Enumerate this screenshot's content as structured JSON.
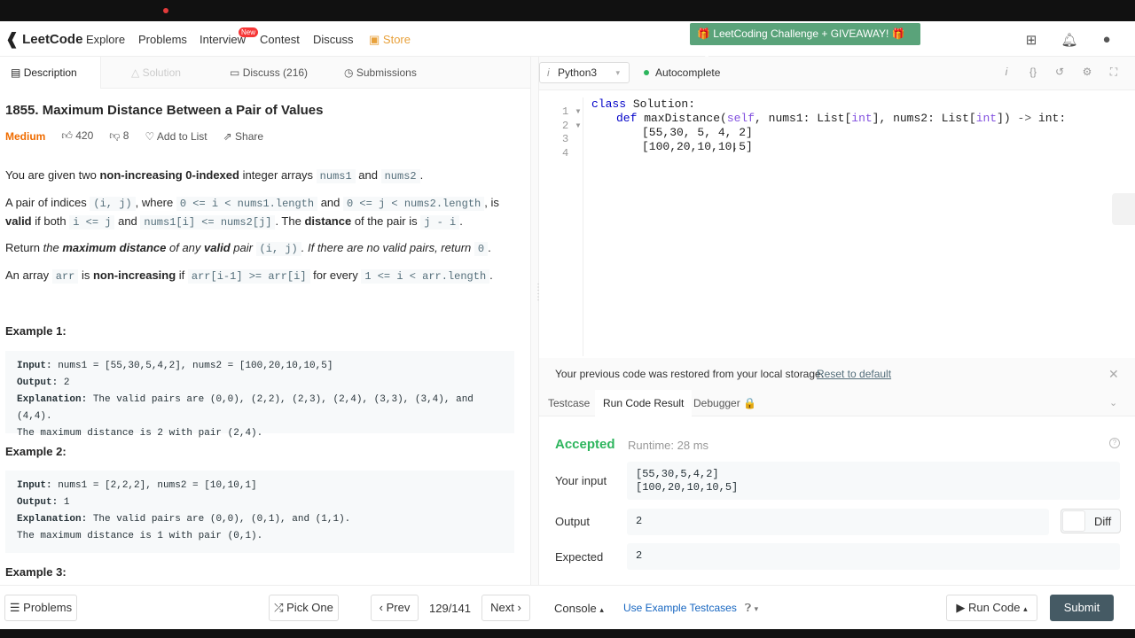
{
  "nav": {
    "logo": "LeetCode",
    "items": [
      "Explore",
      "Problems",
      "Interview",
      "Contest",
      "Discuss"
    ],
    "new_badge": "New",
    "store": "Store",
    "banner": "🎁 LeetCoding Challenge + GIVEAWAY! 🎁"
  },
  "left_tabs": {
    "description": "Description",
    "solution": "Solution",
    "discuss": "Discuss (216)",
    "submissions": "Submissions"
  },
  "problem": {
    "title": "1855. Maximum Distance Between a Pair of Values",
    "difficulty": "Medium",
    "likes": "420",
    "dislikes": "8",
    "add_to_list": "Add to List",
    "share": "Share"
  },
  "desc": {
    "p1a": "You are given two ",
    "p1b": "non-increasing 0-indexed",
    "p1c": " integer arrays ",
    "p1d": "nums1",
    "p1e": " and ",
    "p1f": "nums2",
    "p1g": ".",
    "p2a": "A pair of indices ",
    "p2b": "(i, j)",
    "p2c": ", where ",
    "p2d": "0 <= i < nums1.length",
    "p2e": " and ",
    "p2f": "0 <= j < nums2.length",
    "p2g": ", is",
    "p2h": "valid",
    "p2i": " if both ",
    "p2j": "i <= j",
    "p2k": " and ",
    "p2l": "nums1[i] <= nums2[j]",
    "p2m": ". The ",
    "p2n": "distance",
    "p2o": " of the pair is ",
    "p2p": "j - i",
    "p2q": ".",
    "p3a": "Return ",
    "p3b": "the ",
    "p3c": "maximum distance",
    "p3d": " of any ",
    "p3e": "valid",
    "p3f": " pair ",
    "p3g": "(i, j)",
    "p3h": ". If there are no valid pairs, return ",
    "p3i": "0",
    "p3j": ".",
    "p4a": "An array ",
    "p4b": "arr",
    "p4c": " is ",
    "p4d": "non-increasing",
    "p4e": " if ",
    "p4f": "arr[i-1] >= arr[i]",
    "p4g": " for every ",
    "p4h": "1 <= i < arr.length",
    "p4i": "."
  },
  "examples": [
    {
      "title": "Example 1:",
      "input_label": "Input:",
      "input": " nums1 = [55,30,5,4,2], nums2 = [100,20,10,10,5]",
      "output_label": "Output:",
      "output": " 2",
      "expl_label": "Explanation:",
      "expl": " The valid pairs are (0,0), (2,2), (2,3), (2,4), (3,3), (3,4), and (4,4).",
      "expl2": "The maximum distance is 2 with pair (2,4)."
    },
    {
      "title": "Example 2:",
      "input_label": "Input:",
      "input": " nums1 = [2,2,2], nums2 = [10,10,1]",
      "output_label": "Output:",
      "output": " 1",
      "expl_label": "Explanation:",
      "expl": " The valid pairs are (0,0), (0,1), and (1,1).",
      "expl2": "The maximum distance is 1 with pair (0,1)."
    },
    {
      "title": "Example 3:"
    }
  ],
  "editor": {
    "language": "Python3",
    "autocomplete": "Autocomplete",
    "lines": [
      {
        "num": "1",
        "fold": "▾"
      },
      {
        "num": "2",
        "fold": "▾"
      },
      {
        "num": "3",
        "fold": ""
      },
      {
        "num": "4",
        "fold": ""
      }
    ],
    "code": {
      "l1_kw": "class",
      "l1_rest": " Solution:",
      "l2_kw": "def",
      "l2_a": " maxDistance(",
      "l2_self": "self",
      "l2_b": ", nums1: List[",
      "l2_int1": "int",
      "l2_c": "], nums2: List[",
      "l2_int2": "int",
      "l2_d": "]) ",
      "l2_arrow": "->",
      "l2_e": " int:",
      "l3": "[55,30, 5, 4, 2]",
      "l4": "[100,20,10,10,5]"
    }
  },
  "notice": {
    "text": "Your previous code was restored from your local storage.",
    "reset": "Reset to default"
  },
  "result_tabs": {
    "testcase": "Testcase",
    "run_result": "Run Code Result",
    "debugger": "Debugger 🔒"
  },
  "result": {
    "status": "Accepted",
    "runtime": "Runtime: 28 ms",
    "input_label": "Your input",
    "input_line1": "[55,30,5,4,2]",
    "input_line2": "[100,20,10,10,5]",
    "output_label": "Output",
    "output": "2",
    "diff": "Diff",
    "expected_label": "Expected",
    "expected": "2"
  },
  "bottom": {
    "problems": "Problems",
    "pick_one": "Pick One",
    "prev": "Prev",
    "counter": "129/141",
    "next": "Next",
    "console": "Console",
    "use_example": "Use Example Testcases",
    "run_code": "Run Code",
    "submit": "Submit"
  },
  "colors": {
    "accepted": "#2db55d",
    "medium": "#ef6c00",
    "store": "#e8a13b",
    "banner": "#5aa37a",
    "submit": "#455a64"
  }
}
